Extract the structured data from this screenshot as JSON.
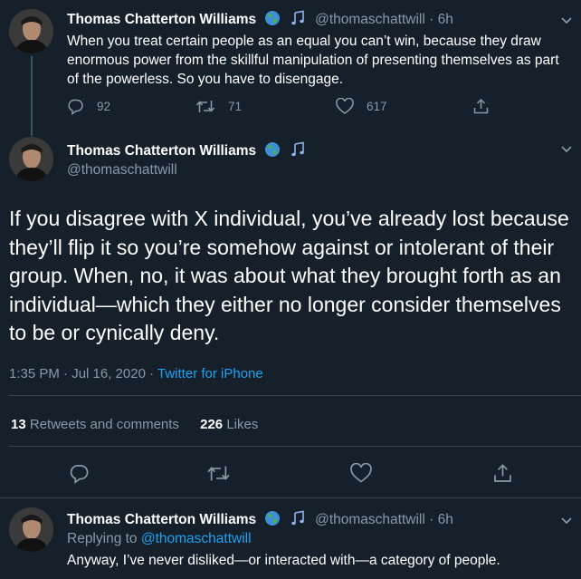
{
  "tweet1": {
    "author_name": "Thomas Chatterton Williams",
    "handle": "@thomaschattwill",
    "separator": "·",
    "time": "6h",
    "text": "When you treat certain people as an equal you can’t win, because they draw enormous power from the skillful manipulation of presenting themselves as part of the powerless. So you have to disengage.",
    "replies": "92",
    "retweets": "71",
    "likes": "617"
  },
  "tweet2": {
    "author_name": "Thomas Chatterton Williams",
    "handle": "@thomaschattwill",
    "text": "If you disagree with X individual, you’ve already lost because they’ll flip it so you’re somehow against or intolerant of their group. When, no, it was about what they brought forth as an individual—which they either no longer consider themselves to be or cynically deny.",
    "timestamp": "1:35 PM · Jul 16, 2020",
    "meta_separator": "·",
    "source": "Twitter for iPhone",
    "retweets_count": "13",
    "retweets_label": "Retweets and comments",
    "likes_count": "226",
    "likes_label": "Likes"
  },
  "tweet3": {
    "author_name": "Thomas Chatterton Williams",
    "handle": "@thomaschattwill",
    "separator": "·",
    "time": "6h",
    "replying_label": "Replying to",
    "replying_to": "@thomaschattwill",
    "text": "Anyway, I’ve never disliked—or interacted with—a category of people."
  },
  "icons": [
    "globe-icon",
    "music-note-icon",
    "chevron-down-icon",
    "reply-icon",
    "retweet-icon",
    "like-icon",
    "share-icon"
  ],
  "colors": {
    "background": "#15202b",
    "text": "#ffffff",
    "muted": "#8899a6",
    "link": "#1da1f2",
    "divider": "#38444d"
  }
}
